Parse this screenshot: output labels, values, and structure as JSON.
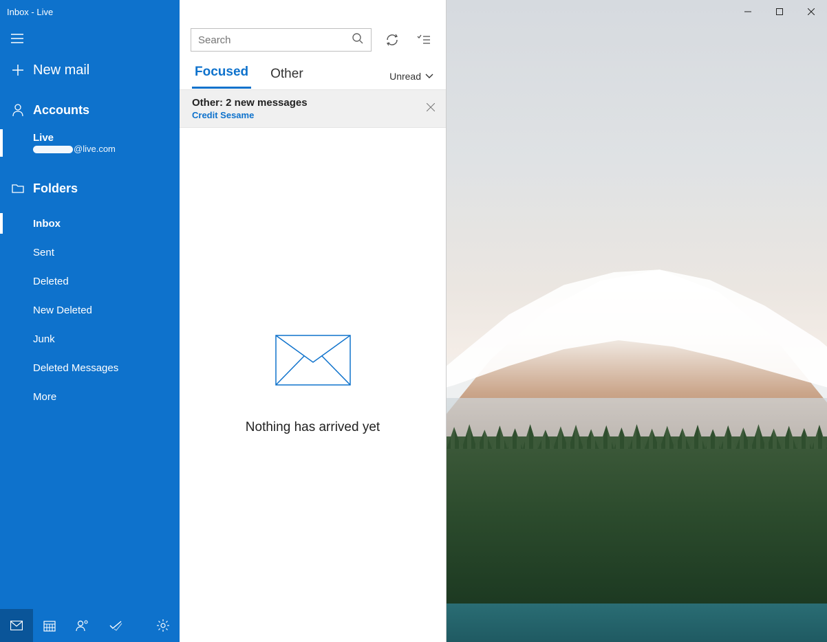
{
  "window": {
    "title": "Inbox - Live"
  },
  "sidebar": {
    "new_mail": "New mail",
    "accounts_label": "Accounts",
    "account": {
      "name": "Live",
      "email_suffix": "@live.com"
    },
    "folders_label": "Folders",
    "folders": [
      {
        "label": "Inbox",
        "selected": true
      },
      {
        "label": "Sent"
      },
      {
        "label": "Deleted"
      },
      {
        "label": "New Deleted"
      },
      {
        "label": "Junk"
      },
      {
        "label": "Deleted Messages"
      },
      {
        "label": "More"
      }
    ]
  },
  "list": {
    "search_placeholder": "Search",
    "tabs": {
      "focused": "Focused",
      "other": "Other"
    },
    "filter_label": "Unread",
    "notice": {
      "title": "Other: 2 new messages",
      "subtitle": "Credit Sesame"
    },
    "empty_message": "Nothing has arrived yet"
  },
  "colors": {
    "accent": "#0e72cc"
  }
}
